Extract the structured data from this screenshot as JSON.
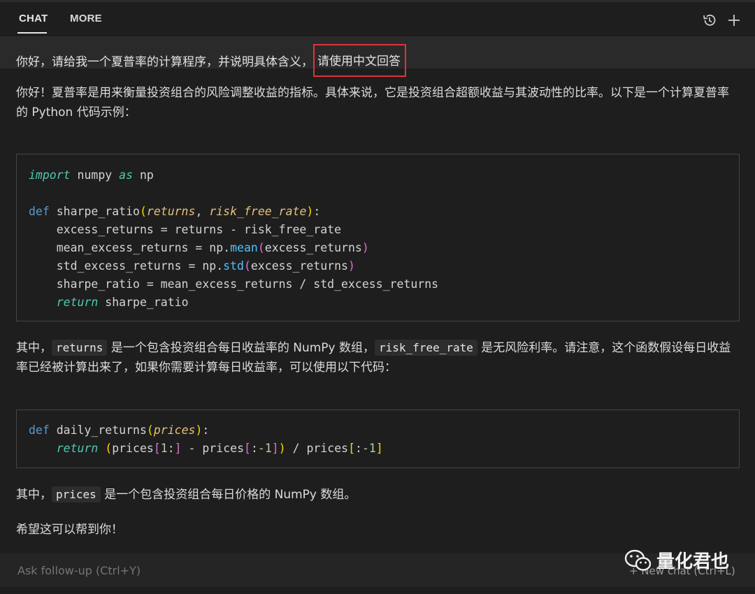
{
  "tabs": {
    "chat": "CHAT",
    "more": "MORE"
  },
  "icons": {
    "history": "history-icon",
    "new": "plus-icon"
  },
  "user_message": {
    "text": "你好，请给我一个夏普率的计算程序，并说明具体含义，",
    "highlighted": "请使用中文回答",
    "highlight_color": "#e0323a"
  },
  "response": {
    "intro": "你好！夏普率是用来衡量投资组合的风险调整收益的指标。具体来说，它是投资组合超额收益与其波动性的比率。以下是一个计算夏普率的 Python 代码示例：",
    "code1": {
      "l1_import": "import",
      "l1_mod": " numpy ",
      "l1_as": "as",
      "l1_alias": " np",
      "l3_def": "def",
      "l3_name": " sharpe_ratio",
      "l3_p1": "returns",
      "l3_p2": "risk_free_rate",
      "l4": "    excess_returns = returns - risk_free_rate",
      "l5_a": "    mean_excess_returns = np.",
      "l5_m": "mean",
      "l5_arg": "excess_returns",
      "l6_a": "    std_excess_returns = np.",
      "l6_m": "std",
      "l6_arg": "excess_returns",
      "l7": "    sharpe_ratio = mean_excess_returns / std_excess_returns",
      "l8_kw": "return",
      "l8_rest": " sharpe_ratio"
    },
    "para2_a": "其中，",
    "para2_code1": "returns",
    "para2_b": "是一个包含投资组合每日收益率的 NumPy 数组，",
    "para2_code2": "risk_free_rate",
    "para2_c": "是无风险利率。请注意，这个函数假设每日收益率已经被计算出来了，如果你需要计算每日收益率，可以使用以下代码：",
    "code2": {
      "l1_def": "def",
      "l1_name": " daily_returns",
      "l1_p": "prices",
      "l2_kw": "return",
      "l2_a": "prices",
      "l2_n1": "1",
      "l2_b": "prices",
      "l2_n2": "-1",
      "l2_c": "prices",
      "l2_n3": "-1"
    },
    "para3_a": "其中，",
    "para3_code": "prices",
    "para3_b": "是一个包含投资组合每日价格的 NumPy 数组。",
    "para4": "希望这可以帮到你！"
  },
  "followup": {
    "placeholder": "Ask follow-up (Ctrl+Y)",
    "new_chat": "+ New chat (Ctrl+L)"
  },
  "watermark": "量化君也"
}
